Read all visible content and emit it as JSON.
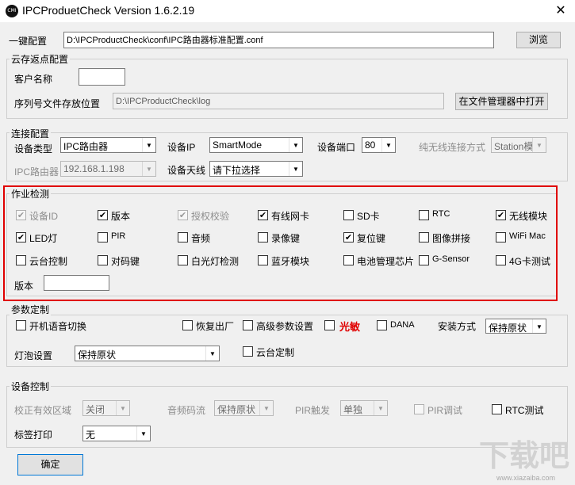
{
  "window": {
    "title": "IPCProduetCheck Version 1.6.2.19",
    "app_icon_text": "CMI"
  },
  "one_key": {
    "label": "一键配置",
    "path": "D:\\IPCProductCheck\\conf\\IPC路由器标准配置.conf",
    "browse": "浏览"
  },
  "cloud": {
    "title": "云存返点配置",
    "customer_label": "客户名称",
    "customer_value": "",
    "serial_path_label": "序列号文件存放位置",
    "serial_path_value": "D:\\IPCProductCheck\\log",
    "open_btn": "在文件管理器中打开"
  },
  "conn": {
    "title": "连接配置",
    "device_type_label": "设备类型",
    "device_type_value": "IPC路由器",
    "device_ip_label": "设备IP",
    "device_ip_value": "SmartMode",
    "device_port_label": "设备端口",
    "device_port_value": "80",
    "wireless_mode_label": "纯无线连接方式",
    "wireless_mode_value": "Station模",
    "ipc_router_label": "IPC路由器",
    "ipc_router_value": "192.168.1.198",
    "antenna_label": "设备天线",
    "antenna_value": "请下拉选择"
  },
  "detect": {
    "title": "作业检测",
    "items": [
      {
        "label": "设备ID",
        "checked": true,
        "disabled": true
      },
      {
        "label": "版本",
        "checked": true,
        "disabled": false
      },
      {
        "label": "授权校验",
        "checked": true,
        "disabled": true
      },
      {
        "label": "有线网卡",
        "checked": true,
        "disabled": false
      },
      {
        "label": "SD卡",
        "checked": false,
        "disabled": false
      },
      {
        "label": "RTC",
        "checked": false,
        "disabled": false
      },
      {
        "label": "无线模块",
        "checked": true,
        "disabled": false
      },
      {
        "label": "LED灯",
        "checked": true,
        "disabled": false
      },
      {
        "label": "PIR",
        "checked": false,
        "disabled": false
      },
      {
        "label": "音频",
        "checked": false,
        "disabled": false
      },
      {
        "label": "录像键",
        "checked": false,
        "disabled": false
      },
      {
        "label": "复位键",
        "checked": true,
        "disabled": false
      },
      {
        "label": "图像拼接",
        "checked": false,
        "disabled": false
      },
      {
        "label": "WiFi Mac",
        "checked": false,
        "disabled": false
      },
      {
        "label": "云台控制",
        "checked": false,
        "disabled": false
      },
      {
        "label": "对码键",
        "checked": false,
        "disabled": false
      },
      {
        "label": "白光灯检测",
        "checked": false,
        "disabled": false
      },
      {
        "label": "蓝牙模块",
        "checked": false,
        "disabled": false
      },
      {
        "label": "电池管理芯片",
        "checked": false,
        "disabled": false
      },
      {
        "label": "G-Sensor",
        "checked": false,
        "disabled": false
      },
      {
        "label": "4G卡测试",
        "checked": false,
        "disabled": false
      }
    ],
    "version_label": "版本",
    "version_value": ""
  },
  "params": {
    "title": "参数定制",
    "boot_voice": "开机语音切换",
    "factory_reset": "恢复出厂",
    "advanced": "高级参数设置",
    "light_sensitive": "光敏",
    "dana": "DANA",
    "install_label": "安装方式",
    "install_value": "保持原状",
    "bulb_label": "灯泡设置",
    "bulb_value": "保持原状",
    "ptz_custom": "云台定制"
  },
  "devctl": {
    "title": "设备控制",
    "valid_area_label": "校正有效区域",
    "valid_area_value": "关闭",
    "audio_stream_label": "音频码流",
    "audio_stream_value": "保持原状",
    "pir_trigger_label": "PIR触发",
    "pir_trigger_value": "单独",
    "pir_debug": "PIR调试",
    "rtc_test": "RTC测试",
    "tag_print_label": "标签打印",
    "tag_print_value": "无"
  },
  "confirm": "确定",
  "watermark": {
    "main": "下载吧",
    "sub": "www.xiazaiba.com"
  }
}
